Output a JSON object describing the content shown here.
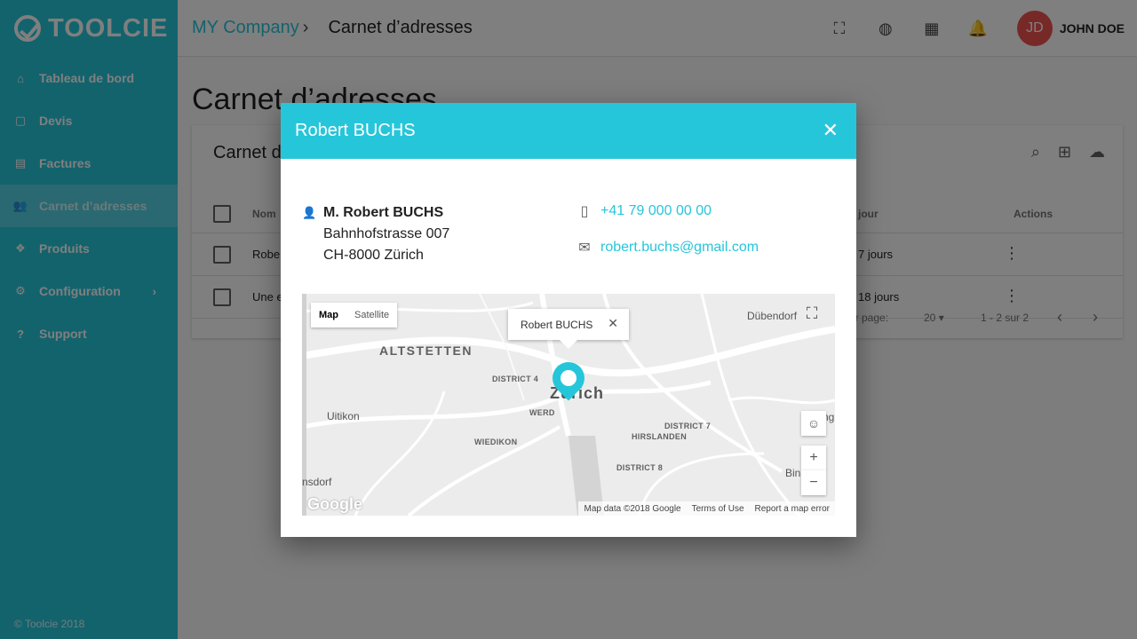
{
  "brand": {
    "name": "TOOLCIE"
  },
  "sidebar": {
    "items": [
      {
        "label": "Tableau de bord",
        "icon": "home-icon"
      },
      {
        "label": "Devis",
        "icon": "quote-icon"
      },
      {
        "label": "Factures",
        "icon": "invoice-icon"
      },
      {
        "label": "Carnet d’adresses",
        "icon": "contacts-icon",
        "active": true
      },
      {
        "label": "Produits",
        "icon": "products-icon"
      },
      {
        "label": "Configuration",
        "icon": "gear-icon"
      },
      {
        "label": "Support",
        "icon": "help-icon"
      }
    ],
    "footer": "© Toolcie 2018"
  },
  "header": {
    "company": "MY Company",
    "separator": "›",
    "page": "Carnet d’adresses",
    "avatar_initials": "JD",
    "user_name": "JOHN DOE"
  },
  "content": {
    "title": "Carnet d’adresses",
    "card_title": "Carnet d",
    "columns": {
      "name": "Nom",
      "updated": "à jour",
      "actions": "Actions"
    },
    "rows": [
      {
        "name": "Rober",
        "updated": "7 jours"
      },
      {
        "name": "Une e",
        "updated": "18 jours"
      }
    ],
    "pager": {
      "per_page_label": "ar page:",
      "per_page": "20",
      "range": "1 - 2 sur 2"
    }
  },
  "dialog": {
    "title": "Robert BUCHS",
    "close": "✕",
    "contact": {
      "name": "M. Robert BUCHS",
      "street": "Bahnhofstrasse 007",
      "city": "CH-8000 Zürich",
      "phone": "+41 79 000 00 00",
      "email": "robert.buchs@gmail.com"
    },
    "map": {
      "type_map": "Map",
      "type_satellite": "Satellite",
      "infowindow": "Robert BUCHS",
      "labels": {
        "altstetten": "ALTSTETTEN",
        "district4": "DISTRICT 4",
        "zurich": "Zürich",
        "werd": "WERD",
        "uitikon": "Uitikon",
        "wiedikon": "WIEDIKON",
        "district7": "DISTRICT 7",
        "hirslanden": "HIRSLANDEN",
        "district8": "DISTRICT 8",
        "dubendorf": "Dübendorf",
        "dorf": "nsdorf",
        "bin": "Bin",
        "ng": "ng"
      },
      "google": "Google",
      "attribution": {
        "data": "Map data ©2018 Google",
        "terms": "Terms of Use",
        "report": "Report a map error"
      },
      "zoom_in": "+",
      "zoom_out": "−"
    }
  }
}
